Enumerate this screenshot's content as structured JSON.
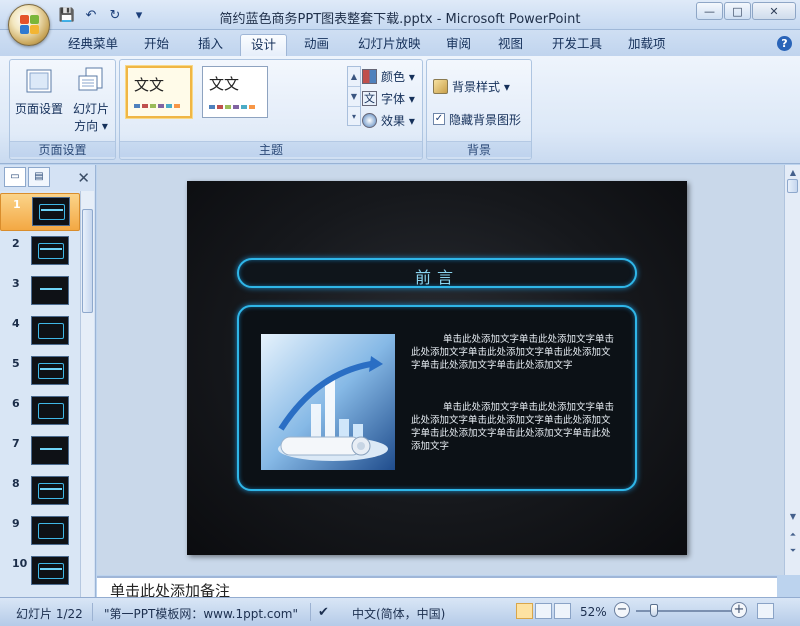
{
  "window": {
    "title": "简约蓝色商务PPT图表整套下载.pptx - Microsoft PowerPoint",
    "minimize": "—",
    "maximize": "□",
    "close": "✕"
  },
  "qat": {
    "save": "💾",
    "undo": "↶",
    "redo": "↻",
    "more": "▾"
  },
  "tabs": [
    {
      "label": "经典菜单"
    },
    {
      "label": "开始"
    },
    {
      "label": "插入"
    },
    {
      "label": "设计",
      "active": true
    },
    {
      "label": "动画"
    },
    {
      "label": "幻灯片放映"
    },
    {
      "label": "审阅"
    },
    {
      "label": "视图"
    },
    {
      "label": "开发工具"
    },
    {
      "label": "加载项"
    }
  ],
  "help": "?",
  "ribbon": {
    "page_setup": {
      "label": "页面设置",
      "page_setup_btn": "页面设置",
      "orientation_btn_line1": "幻灯片",
      "orientation_btn_line2": "方向 ▾"
    },
    "themes": {
      "label": "主题",
      "thumb1": "文文",
      "thumb2": "文文",
      "colors": "颜色 ▾",
      "fonts": "字体 ▾",
      "effects": "效果 ▾",
      "font_icon": "文"
    },
    "background": {
      "label": "背景",
      "styles": "背景样式 ▾",
      "hide_graphics": "隐藏背景图形",
      "checked": "✓"
    }
  },
  "slides_pane": {
    "outline_tab": "▤",
    "slides_tab": "▭",
    "close": "✕",
    "slides": [
      "1",
      "2",
      "3",
      "4",
      "5",
      "6",
      "7",
      "8",
      "9",
      "10"
    ]
  },
  "slide": {
    "title": "前言",
    "paragraph1": "单击此处添加文字单击此处添加文字单击此处添加文字单击此处添加文字单击此处添加文字单击此处添加文字单击此处添加文字",
    "paragraph2": "单击此处添加文字单击此处添加文字单击此处添加文字单击此处添加文字单击此处添加文字单击此处添加文字单击此处添加文字单击此处添加文字"
  },
  "notes": {
    "placeholder": "单击此处添加备注"
  },
  "status": {
    "slide_count": "幻灯片 1/22",
    "template": "\"第一PPT模板网：www.1ppt.com\"",
    "language": "中文(简体，中国)",
    "zoom": "52%",
    "zoom_out": "−",
    "zoom_in": "+"
  },
  "colors": {
    "accent_glow": "#2fb6e8",
    "selected_thumb": "#f3a843",
    "ribbon_bg": "#dce8f7"
  }
}
